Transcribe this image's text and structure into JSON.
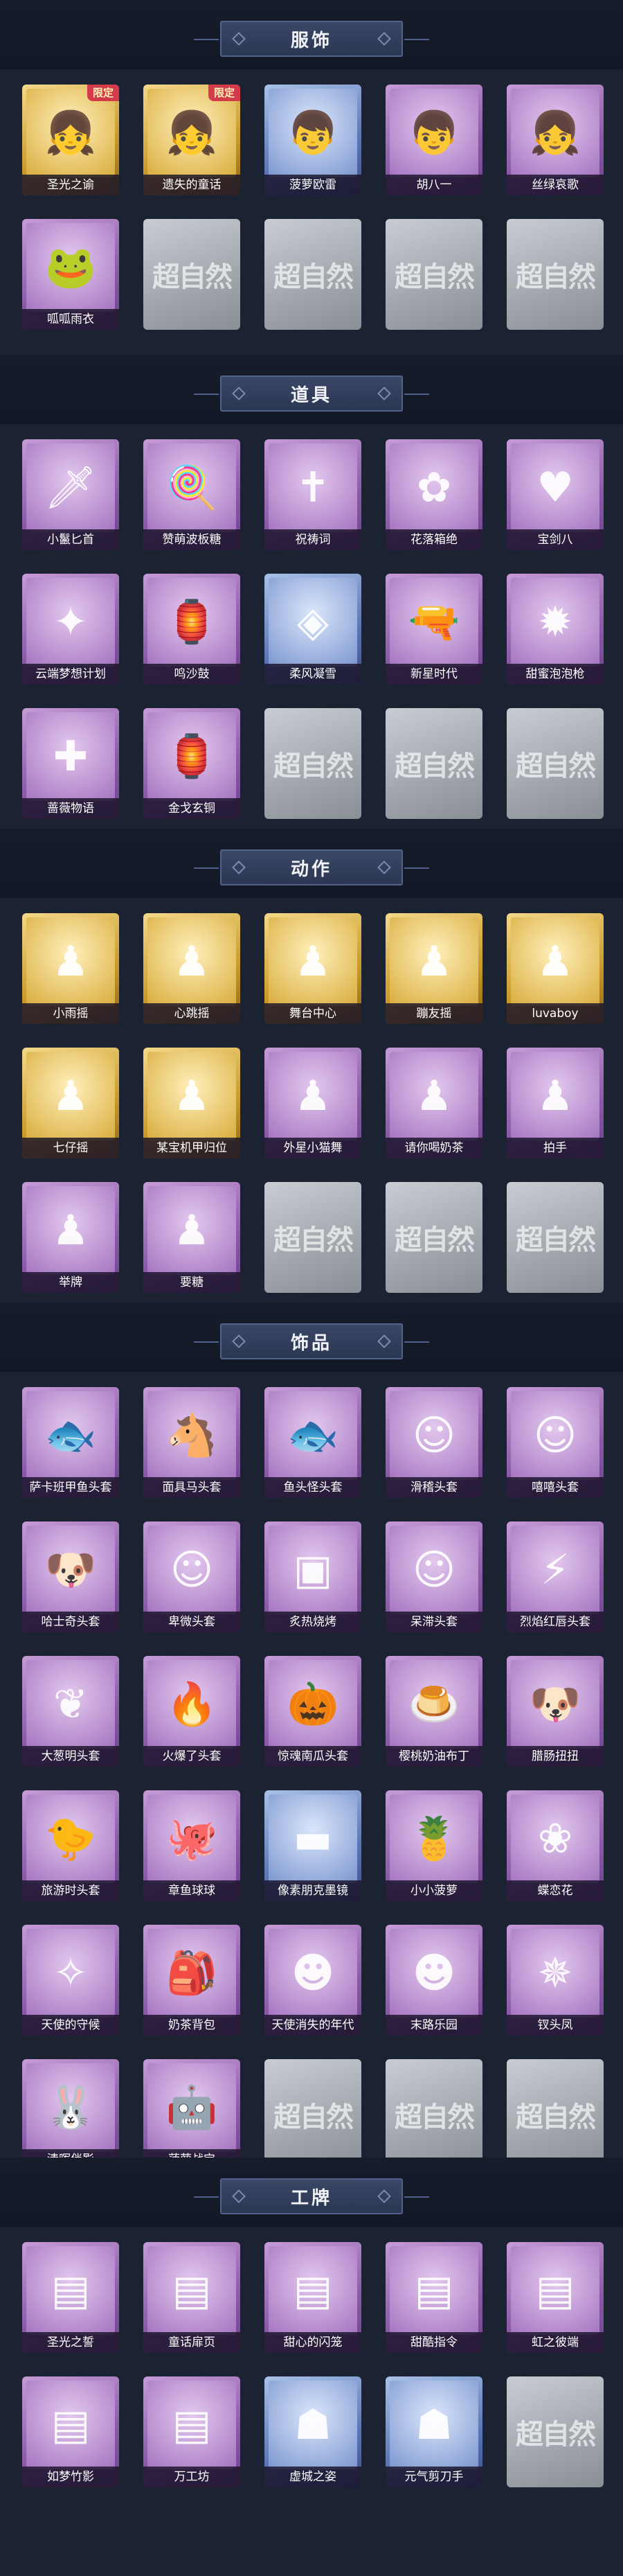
{
  "sections": [
    {
      "title": "服饰",
      "items": [
        {
          "label": "圣光之谕",
          "variant": "gold",
          "icon": "girl-portrait-icon",
          "badge": "限定"
        },
        {
          "label": "遗失的童话",
          "variant": "gold",
          "icon": "girl-portrait-icon",
          "badge": "限定"
        },
        {
          "label": "菠萝欧雷",
          "variant": "blue",
          "icon": "boy-portrait-icon"
        },
        {
          "label": "胡八一",
          "variant": "purple",
          "icon": "boy-portrait-icon"
        },
        {
          "label": "丝绿哀歌",
          "variant": "purple",
          "icon": "girl-portrait-icon"
        },
        {
          "label": "呱呱雨衣",
          "variant": "purple",
          "icon": "frog-hood-icon"
        },
        {
          "placeholder": "超自然"
        },
        {
          "placeholder": "超自然"
        },
        {
          "placeholder": "超自然"
        },
        {
          "placeholder": "超自然"
        }
      ]
    },
    {
      "title": "道具",
      "items": [
        {
          "label": "小鬣匕首",
          "variant": "purple",
          "icon": "dagger-icon"
        },
        {
          "label": "赞萌波板糖",
          "variant": "purple",
          "icon": "lollipop-icon"
        },
        {
          "label": "祝祷词",
          "variant": "purple",
          "icon": "cross-pendant-icon"
        },
        {
          "label": "花落箱绝",
          "variant": "purple",
          "icon": "flower-icon"
        },
        {
          "label": "宝剑八",
          "variant": "purple",
          "icon": "heart-icon"
        },
        {
          "label": "云端梦想计划",
          "variant": "purple",
          "icon": "wand-icon"
        },
        {
          "label": "鸣沙鼓",
          "variant": "purple",
          "icon": "lantern-icon"
        },
        {
          "label": "柔风凝雪",
          "variant": "blue",
          "icon": "gem-icon"
        },
        {
          "label": "新星时代",
          "variant": "purple",
          "icon": "revolver-icon"
        },
        {
          "label": "甜蜜泡泡枪",
          "variant": "purple",
          "icon": "bubble-gun-icon"
        },
        {
          "label": "蔷薇物语",
          "variant": "purple",
          "icon": "first-aid-icon"
        },
        {
          "label": "金戈玄铜",
          "variant": "purple",
          "icon": "lantern-icon"
        },
        {
          "placeholder": "超自然"
        },
        {
          "placeholder": "超自然"
        },
        {
          "placeholder": "超自然"
        }
      ]
    },
    {
      "title": "动作",
      "items": [
        {
          "label": "小雨摇",
          "variant": "gold",
          "icon": "pose-icon"
        },
        {
          "label": "心跳摇",
          "variant": "gold",
          "icon": "pose-icon"
        },
        {
          "label": "舞台中心",
          "variant": "gold",
          "icon": "pose-icon"
        },
        {
          "label": "蹦友摇",
          "variant": "gold",
          "icon": "pose-icon"
        },
        {
          "label": "luvaboy",
          "variant": "gold",
          "icon": "pose-icon"
        },
        {
          "label": "七仔摇",
          "variant": "gold",
          "icon": "pose-icon"
        },
        {
          "label": "某宝机甲归位",
          "variant": "gold",
          "icon": "pose-icon"
        },
        {
          "label": "外星小猫舞",
          "variant": "purple",
          "icon": "pose-icon"
        },
        {
          "label": "请你喝奶茶",
          "variant": "purple",
          "icon": "pose-icon"
        },
        {
          "label": "拍手",
          "variant": "purple",
          "icon": "pose-icon"
        },
        {
          "label": "举牌",
          "variant": "purple",
          "icon": "pose-icon"
        },
        {
          "label": "要糖",
          "variant": "purple",
          "icon": "pose-icon"
        },
        {
          "placeholder": "超自然"
        },
        {
          "placeholder": "超自然"
        },
        {
          "placeholder": "超自然"
        }
      ]
    },
    {
      "title": "饰品",
      "items": [
        {
          "label": "萨卡班甲鱼头套",
          "variant": "purple",
          "icon": "fish-head-icon"
        },
        {
          "label": "面具马头套",
          "variant": "purple",
          "icon": "horse-head-icon"
        },
        {
          "label": "鱼头怪头套",
          "variant": "purple",
          "icon": "fish-head-icon"
        },
        {
          "label": "滑稽头套",
          "variant": "purple",
          "icon": "smiley-icon"
        },
        {
          "label": "嘻嘻头套",
          "variant": "purple",
          "icon": "smiley-icon"
        },
        {
          "label": "哈士奇头套",
          "variant": "purple",
          "icon": "dog-head-icon"
        },
        {
          "label": "卑微头套",
          "variant": "purple",
          "icon": "smiley-icon"
        },
        {
          "label": "炙热烧烤",
          "variant": "purple",
          "icon": "toast-icon"
        },
        {
          "label": "呆滞头套",
          "variant": "purple",
          "icon": "smiley-icon"
        },
        {
          "label": "烈焰红唇头套",
          "variant": "purple",
          "icon": "pikachu-icon"
        },
        {
          "label": "大葱明头套",
          "variant": "purple",
          "icon": "leek-icon"
        },
        {
          "label": "火爆了头套",
          "variant": "purple",
          "icon": "fire-icon"
        },
        {
          "label": "惊魂南瓜头套",
          "variant": "purple",
          "icon": "pumpkin-icon"
        },
        {
          "label": "樱桃奶油布丁",
          "variant": "purple",
          "icon": "pudding-icon"
        },
        {
          "label": "腊肠扭扭",
          "variant": "purple",
          "icon": "dog-head-icon"
        },
        {
          "label": "旅游时头套",
          "variant": "purple",
          "icon": "bird-head-icon"
        },
        {
          "label": "章鱼球球",
          "variant": "purple",
          "icon": "octopus-icon"
        },
        {
          "label": "像素朋克墨镜",
          "variant": "blue",
          "icon": "sunglasses-icon"
        },
        {
          "label": "小小菠萝",
          "variant": "purple",
          "icon": "pineapple-icon"
        },
        {
          "label": "蝶恋花",
          "variant": "purple",
          "icon": "butterfly-icon"
        },
        {
          "label": "天使的守候",
          "variant": "purple",
          "icon": "angel-icon"
        },
        {
          "label": "奶茶背包",
          "variant": "purple",
          "icon": "backpack-icon"
        },
        {
          "label": "天使消失的年代",
          "variant": "purple",
          "icon": "doll-icon"
        },
        {
          "label": "末路乐园",
          "variant": "purple",
          "icon": "doll-icon"
        },
        {
          "label": "钗头凤",
          "variant": "purple",
          "icon": "phoenix-icon"
        },
        {
          "label": "清晖伴影",
          "variant": "purple",
          "icon": "bunny-icon"
        },
        {
          "label": "菠萝战宝",
          "variant": "purple",
          "icon": "robot-icon"
        },
        {
          "placeholder": "超自然"
        },
        {
          "placeholder": "超自然"
        },
        {
          "placeholder": "超自然"
        }
      ]
    },
    {
      "title": "工牌",
      "items": [
        {
          "label": "圣光之誓",
          "variant": "purple",
          "icon": "badge-card-icon"
        },
        {
          "label": "童话扉页",
          "variant": "purple",
          "icon": "badge-card-icon"
        },
        {
          "label": "甜心的闪笼",
          "variant": "purple",
          "icon": "badge-card-icon"
        },
        {
          "label": "甜酷指令",
          "variant": "purple",
          "icon": "badge-card-icon"
        },
        {
          "label": "虹之彼端",
          "variant": "purple",
          "icon": "badge-card-icon"
        },
        {
          "label": "如梦竹影",
          "variant": "purple",
          "icon": "badge-card-icon"
        },
        {
          "label": "万工坊",
          "variant": "purple",
          "icon": "badge-card-icon"
        },
        {
          "label": "虚城之姿",
          "variant": "blue",
          "icon": "silhouette-card-icon"
        },
        {
          "label": "元气剪刀手",
          "variant": "blue",
          "icon": "silhouette-card-icon"
        },
        {
          "placeholder": "超自然"
        }
      ]
    }
  ]
}
